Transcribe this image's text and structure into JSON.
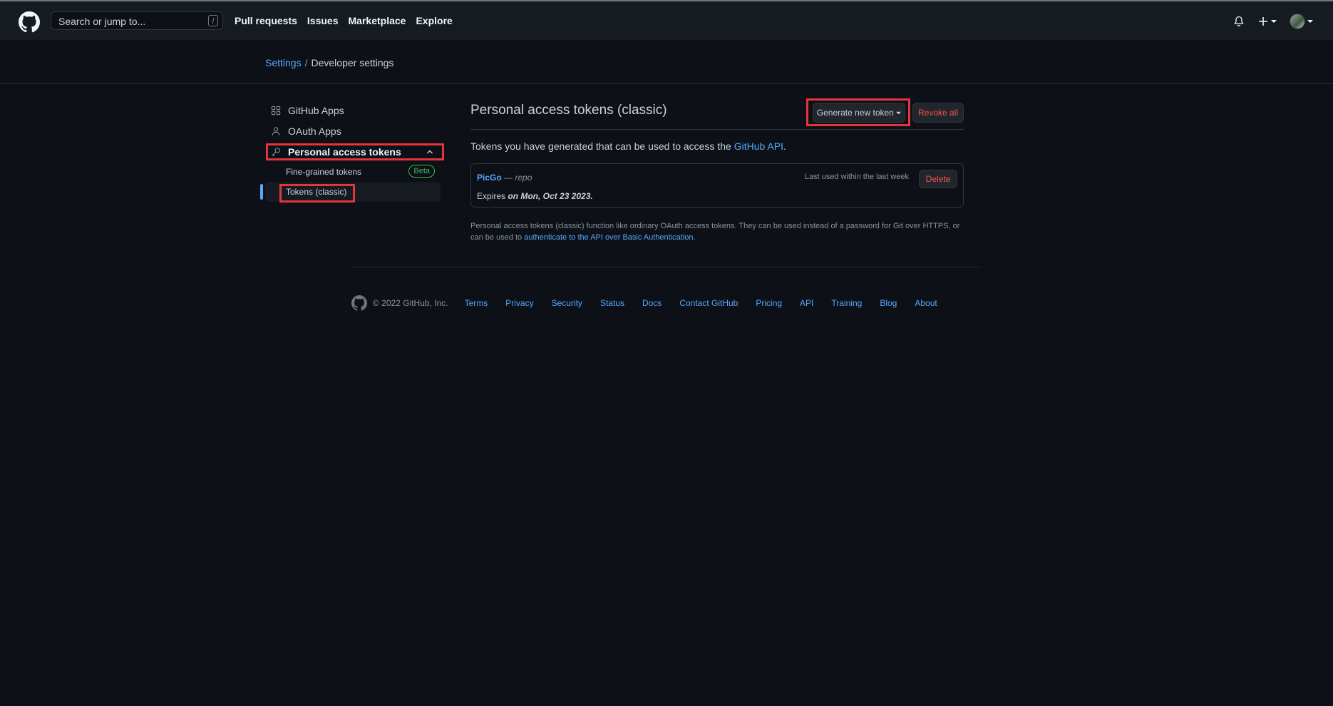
{
  "header": {
    "search_placeholder": "Search or jump to...",
    "slash_key": "/",
    "nav": [
      "Pull requests",
      "Issues",
      "Marketplace",
      "Explore"
    ]
  },
  "breadcrumb": {
    "parent": "Settings",
    "separator": "/",
    "current": "Developer settings"
  },
  "sidebar": {
    "github_apps": "GitHub Apps",
    "oauth_apps": "OAuth Apps",
    "personal_tokens": "Personal access tokens",
    "fine_grained": "Fine-grained tokens",
    "beta_badge": "Beta",
    "classic": "Tokens (classic)"
  },
  "main": {
    "title": "Personal access tokens (classic)",
    "generate_button": "Generate new token",
    "revoke_button": "Revoke all",
    "description_prefix": "Tokens you have generated that can be used to access the ",
    "description_link": "GitHub API",
    "description_suffix": ".",
    "token": {
      "name": "PicGo",
      "separator": " — ",
      "scope": "repo",
      "last_used": "Last used within the last week",
      "delete_button": "Delete",
      "expires_prefix": "Expires ",
      "expires_date": "on Mon, Oct 23 2023."
    },
    "note_text": "Personal access tokens (classic) function like ordinary OAuth access tokens. They can be used instead of a password for Git over HTTPS, or can be used to ",
    "note_link": "authenticate to the API over Basic Authentication",
    "note_suffix": "."
  },
  "footer": {
    "copyright": "© 2022 GitHub, Inc.",
    "links": [
      "Terms",
      "Privacy",
      "Security",
      "Status",
      "Docs",
      "Contact GitHub",
      "Pricing",
      "API",
      "Training",
      "Blog",
      "About"
    ]
  },
  "colors": {
    "background": "#0d1117",
    "header": "#161b22",
    "link": "#58a6ff",
    "danger": "#f85149",
    "beta": "#3fb950",
    "highlight": "#e5343b"
  }
}
